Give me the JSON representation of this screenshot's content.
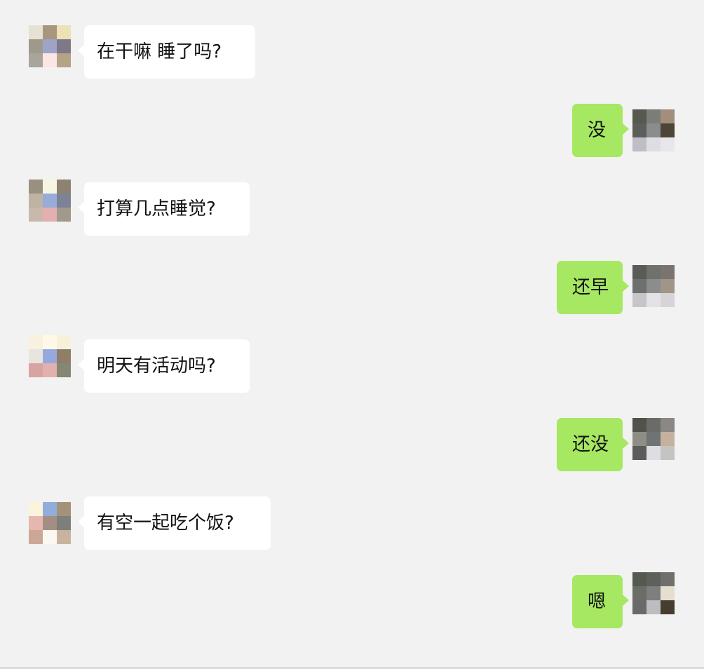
{
  "conversation": {
    "messages": [
      {
        "direction": "incoming",
        "text": "在干嘛 睡了吗?",
        "avatar_icon": "pixelated-avatar-icon"
      },
      {
        "direction": "outgoing",
        "text": "没",
        "avatar_icon": "pixelated-avatar-icon"
      },
      {
        "direction": "incoming",
        "text": "打算几点睡觉?",
        "avatar_icon": "pixelated-avatar-icon"
      },
      {
        "direction": "outgoing",
        "text": "还早",
        "avatar_icon": "pixelated-avatar-icon"
      },
      {
        "direction": "incoming",
        "text": "明天有活动吗?",
        "avatar_icon": "pixelated-avatar-icon"
      },
      {
        "direction": "outgoing",
        "text": "还没",
        "avatar_icon": "pixelated-avatar-icon"
      },
      {
        "direction": "incoming",
        "text": "有空一起吃个饭?",
        "avatar_icon": "pixelated-avatar-icon"
      },
      {
        "direction": "outgoing",
        "text": "嗯",
        "avatar_icon": "pixelated-avatar-icon"
      }
    ]
  },
  "colors": {
    "background": "#f2f2f2",
    "incoming_bubble": "#ffffff",
    "outgoing_bubble": "#a6e861",
    "text": "#111111"
  }
}
